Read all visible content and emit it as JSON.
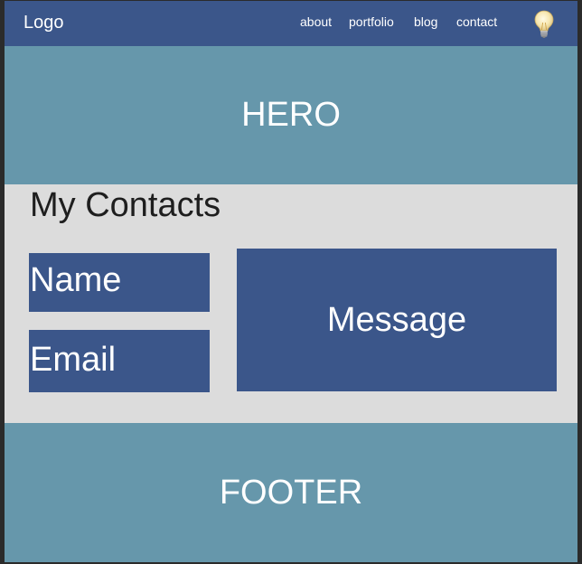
{
  "nav": {
    "logo": "Logo",
    "links": [
      "about",
      "portfolio",
      "blog",
      "contact"
    ],
    "theme_icon": "lightbulb-icon"
  },
  "hero": {
    "label": "HERO"
  },
  "contacts": {
    "title": "My Contacts",
    "name_label": "Name",
    "email_label": "Email",
    "message_label": "Message"
  },
  "footer": {
    "label": "FOOTER"
  },
  "colors": {
    "nav": "#3b568a",
    "hero": "#6697ab",
    "section": "#dcdcdc",
    "field": "#3b568a",
    "footer": "#6697ab"
  }
}
